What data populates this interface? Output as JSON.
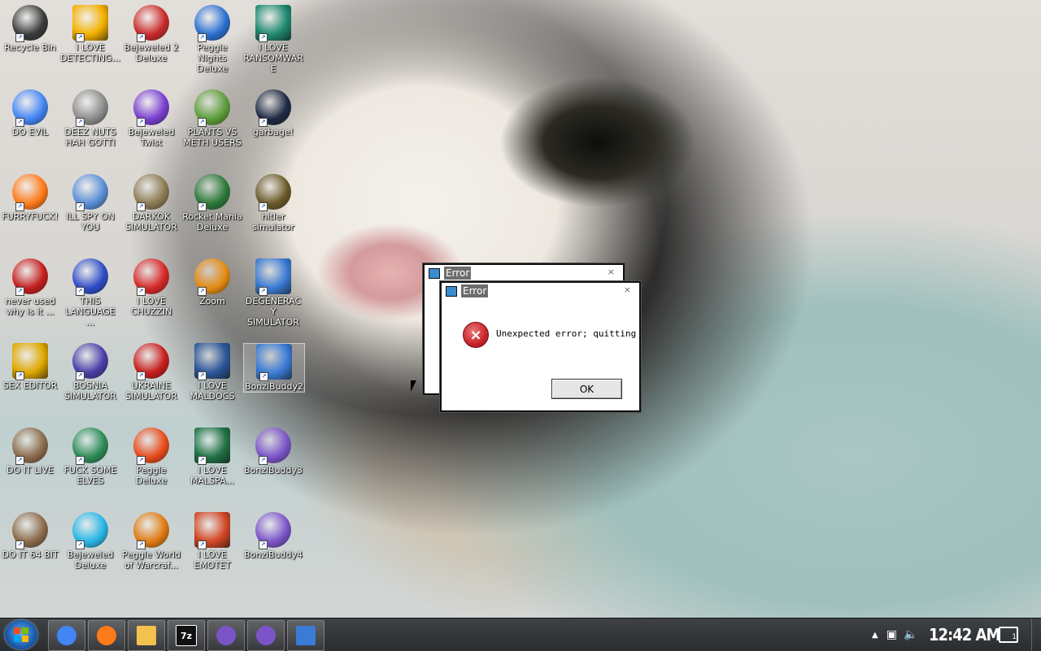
{
  "desktop": {
    "icons": [
      {
        "label": "Recycle Bin",
        "icon": "recycle-bin-icon",
        "color": "#3b3b3b"
      },
      {
        "label": "I LOVE DETECTING...",
        "icon": "de-icon",
        "color": "#f4b000"
      },
      {
        "label": "Bejeweled 2 Deluxe",
        "icon": "bejeweled2-icon",
        "color": "#c92a2a"
      },
      {
        "label": "Peggle Nights Deluxe",
        "icon": "peggle-nights-icon",
        "color": "#2c6fd0"
      },
      {
        "label": "I LOVE RANSOMWARE",
        "icon": "publisher-icon",
        "color": "#1f8a70"
      },
      {
        "label": "DO EVIL",
        "icon": "chrome-icon",
        "color": "#4285f4"
      },
      {
        "label": "DEEZ NUTS HAH GOTTI",
        "icon": "windows-stack-icon",
        "color": "#8c8c8c"
      },
      {
        "label": "Bejeweled Twist",
        "icon": "bejeweled-twist-icon",
        "color": "#7a3fd1"
      },
      {
        "label": "PLANTS VS METH USERS",
        "icon": "plants-icon",
        "color": "#5d9e3a"
      },
      {
        "label": "garbage!",
        "icon": "garbage-icon",
        "color": "#1e2a44"
      },
      {
        "label": "FURRYFUCK!",
        "icon": "firefox-icon",
        "color": "#ff7a1a"
      },
      {
        "label": "ILL SPY ON YOU",
        "icon": "spy-icon",
        "color": "#5a8ed6"
      },
      {
        "label": "DARKOK SIMULATOR",
        "icon": "money-bag-icon",
        "color": "#8d7b54"
      },
      {
        "label": "Rocket Mania Deluxe",
        "icon": "rocket-icon",
        "color": "#2b7a3a"
      },
      {
        "label": "hitler simulator",
        "icon": "medal-icon",
        "color": "#6a5a2a"
      },
      {
        "label": "never used why is it ...",
        "icon": "devcpp-icon",
        "color": "#c41e1e"
      },
      {
        "label": "THIS LANGUAGE ...",
        "icon": "goland-icon",
        "color": "#2f4cc7"
      },
      {
        "label": "I LOVE CHUZZIN",
        "icon": "chuzzle-icon",
        "color": "#d62828"
      },
      {
        "label": "Zoom",
        "icon": "zoom-icon",
        "color": "#e48a12"
      },
      {
        "label": "DEGENERACY SIMULATOR",
        "icon": "program-icon",
        "color": "#3a7bd5"
      },
      {
        "label": "SEX EDITOR",
        "icon": "hxd-icon",
        "color": "#e0a800"
      },
      {
        "label": "BOSNIA SIMULATOR",
        "icon": "mine-icon",
        "color": "#4b3ea8"
      },
      {
        "label": "UKRAINE SIMULATOR",
        "icon": "radiation-icon",
        "color": "#c81d1d"
      },
      {
        "label": "I LOVE MALDOCS",
        "icon": "word-icon",
        "color": "#2b579a"
      },
      {
        "label": "BonziBuddy2",
        "icon": "program-icon",
        "color": "#3a7bd5"
      },
      {
        "label": "DO IT LIVE",
        "icon": "portrait-icon",
        "color": "#8b6b4a"
      },
      {
        "label": "FUCK SOME ELVES",
        "icon": "globe-santa-icon",
        "color": "#2e8b57"
      },
      {
        "label": "Peggle Deluxe",
        "icon": "peggle-icon",
        "color": "#e84a1a"
      },
      {
        "label": "I LOVE MALSPA...",
        "icon": "excel-icon",
        "color": "#217346"
      },
      {
        "label": "BonziBuddy3",
        "icon": "bonzi-icon",
        "color": "#7b54c8"
      },
      {
        "label": "DO IT 64 BIT",
        "icon": "portrait64-icon",
        "color": "#8b6b4a"
      },
      {
        "label": "Bejeweled Deluxe",
        "icon": "diamond-icon",
        "color": "#27b6e6"
      },
      {
        "label": "Peggle World of Warcraf...",
        "icon": "peggle-wow-icon",
        "color": "#e07a12"
      },
      {
        "label": "I LOVE EMOTET",
        "icon": "powerpoint-icon",
        "color": "#d24726"
      },
      {
        "label": "BonziBuddy4",
        "icon": "bonzi-icon",
        "color": "#7b54c8"
      }
    ]
  },
  "dialogs": {
    "back": {
      "title": "Error"
    },
    "front": {
      "title": "Error",
      "close": "×",
      "message": "Unexpected error; quitting",
      "ok_label": "OK",
      "error_symbol": "×"
    }
  },
  "taskbar": {
    "buttons": [
      {
        "name": "chrome-taskbar-button",
        "icon": "chrome-icon"
      },
      {
        "name": "firefox-taskbar-button",
        "icon": "firefox-icon"
      },
      {
        "name": "explorer-taskbar-button",
        "icon": "folder-icon"
      },
      {
        "name": "7zip-taskbar-button",
        "icon": "7zip-icon",
        "text": "7z"
      },
      {
        "name": "bonzi-taskbar-button-1",
        "icon": "bonzi-icon"
      },
      {
        "name": "bonzi-taskbar-button-2",
        "icon": "bonzi-icon"
      },
      {
        "name": "program-taskbar-button",
        "icon": "program-icon"
      }
    ],
    "clock": "12:42 AM",
    "notification_count": "1"
  }
}
